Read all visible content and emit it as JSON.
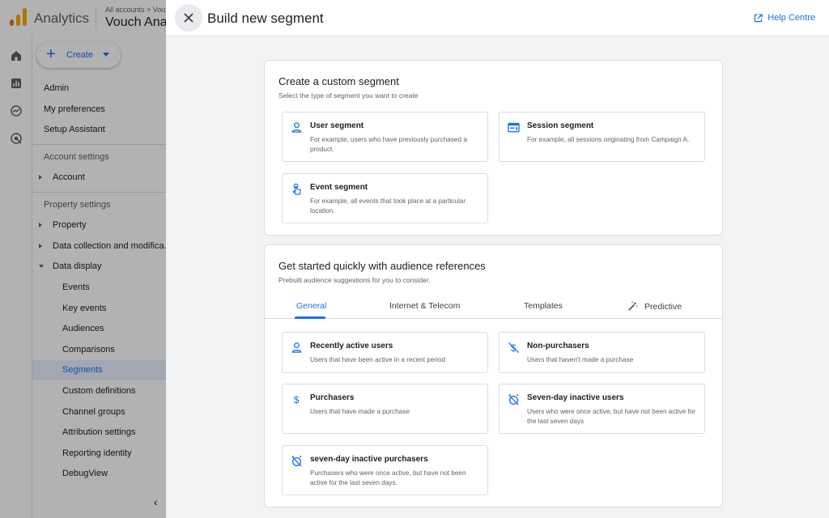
{
  "app": {
    "name": "Analytics",
    "breadcrumb": "All accounts > Vou",
    "account_name": "Vouch Ana"
  },
  "sidenav": {
    "create_label": "Create",
    "items": [
      "Admin",
      "My preferences",
      "Setup Assistant"
    ],
    "account_settings": "Account settings",
    "account": "Account",
    "property_settings": "Property settings",
    "property": "Property",
    "data_collection": "Data collection and modifica...",
    "data_display": "Data display",
    "sub_items": [
      "Events",
      "Key events",
      "Audiences",
      "Comparisons",
      "Segments",
      "Custom definitions",
      "Channel groups",
      "Attribution settings",
      "Reporting identity",
      "DebugView"
    ],
    "active_item": "Segments"
  },
  "panel": {
    "title": "Build new segment",
    "help_label": "Help Centre"
  },
  "custom_segment": {
    "title": "Create a custom segment",
    "subtitle": "Select the type of segment you want to create",
    "options": [
      {
        "title": "User segment",
        "desc": "For example, users who have previously purchased a product.",
        "icon": "person-icon"
      },
      {
        "title": "Session segment",
        "desc": "For example, all sessions originating from Campaign A.",
        "icon": "session-icon"
      },
      {
        "title": "Event segment",
        "desc": "For example, all events that took place at a particular location.",
        "icon": "touch-icon"
      }
    ]
  },
  "audience_refs": {
    "title": "Get started quickly with audience references",
    "subtitle": "Prebuilt audience suggestions for you to consider.",
    "tabs": [
      "General",
      "Internet & Telecom",
      "Templates",
      "Predictive"
    ],
    "active_tab": "General",
    "options": [
      {
        "title": "Recently active users",
        "desc": "Users that have been active in a recent period",
        "icon": "person-icon"
      },
      {
        "title": "Non-purchasers",
        "desc": "Users that haven't made a purchase",
        "icon": "no-money-icon"
      },
      {
        "title": "Purchasers",
        "desc": "Users that have made a purchase",
        "icon": "dollar-icon"
      },
      {
        "title": "Seven-day inactive users",
        "desc": "Users who were once active, but have not been active for the last seven days",
        "icon": "alarm-off-icon"
      },
      {
        "title": "seven-day inactive purchasers",
        "desc": "Purchasers who were once active, but have not been active for the last seven days.",
        "icon": "alarm-off-icon"
      }
    ]
  },
  "colors": {
    "accent": "#1a73e8",
    "logo_orange": "#f9ab00",
    "logo_dark": "#e37400"
  }
}
